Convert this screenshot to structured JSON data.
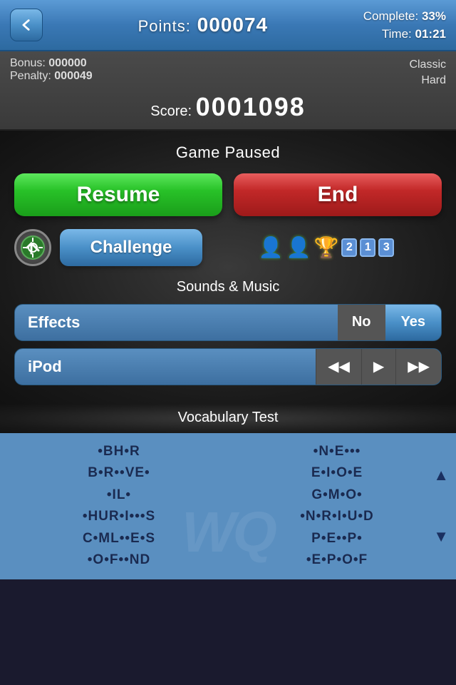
{
  "topBar": {
    "backLabel": "◀",
    "pointsLabel": "Points:",
    "pointsValue": "000074",
    "completeLabel": "Complete:",
    "completeValue": "33%",
    "timeLabel": "Time:",
    "timeValue": "01:21"
  },
  "scoreBar": {
    "bonusLabel": "Bonus:",
    "bonusValue": "000000",
    "penaltyLabel": "Penalty:",
    "penaltyValue": "000049",
    "modeLine1": "Classic",
    "modeLine2": "Hard",
    "scoreLabel": "Score:",
    "scoreValue": "0001098"
  },
  "pause": {
    "gamePausedLabel": "Game Paused",
    "resumeLabel": "Resume",
    "endLabel": "End",
    "challengeLabel": "Challenge",
    "badge1": "2",
    "badge2": "1",
    "badge3": "3"
  },
  "sounds": {
    "sectionLabel": "Sounds & Music",
    "effectsLabel": "Effects",
    "noLabel": "No",
    "yesLabel": "Yes",
    "ipodLabel": "iPod",
    "rewindLabel": "◀◀",
    "playLabel": "▶",
    "forwardLabel": "▶▶"
  },
  "vocab": {
    "sectionLabel": "Vocabulary Test",
    "leftWords": [
      "•BH•R",
      "B•R••VE•",
      "•IL•",
      "•HUR•I•••S",
      "C•ML••E•S",
      "•O•F••ND"
    ],
    "rightWords": [
      "•N•E•••",
      "E•I•O•E",
      "G•M•O•",
      "•N•R•I•U•D",
      "P•E••P•",
      "•E•P•O•F"
    ]
  }
}
